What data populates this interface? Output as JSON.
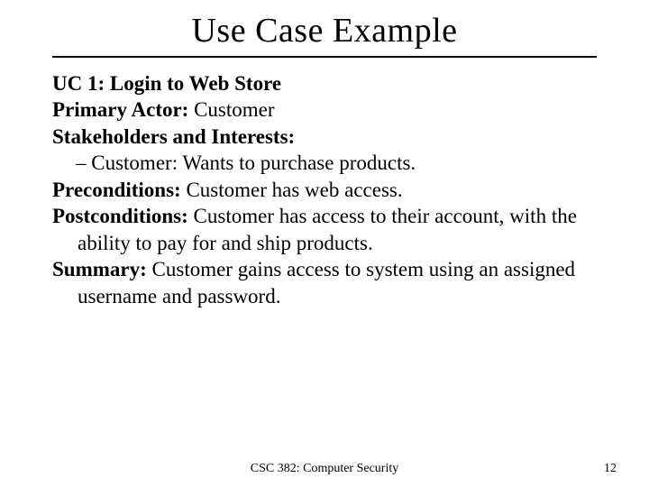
{
  "title": "Use Case Example",
  "uc": {
    "id_line": "UC 1: Login to Web Store",
    "primary_actor_label": "Primary Actor:",
    "primary_actor_value": " Customer",
    "stakeholders_label": "Stakeholders and Interests:",
    "stakeholder_item": "– Customer: Wants to purchase products.",
    "preconditions_label": "Preconditions:",
    "preconditions_value": " Customer has web access.",
    "postconditions_label": "Postconditions:",
    "postconditions_value": " Customer has access to their account, with the ability to pay for and ship products.",
    "summary_label": "Summary:",
    "summary_value": " Customer gains access to system using an assigned username and password."
  },
  "footer": {
    "course": "CSC 382: Computer Security",
    "page": "12"
  }
}
